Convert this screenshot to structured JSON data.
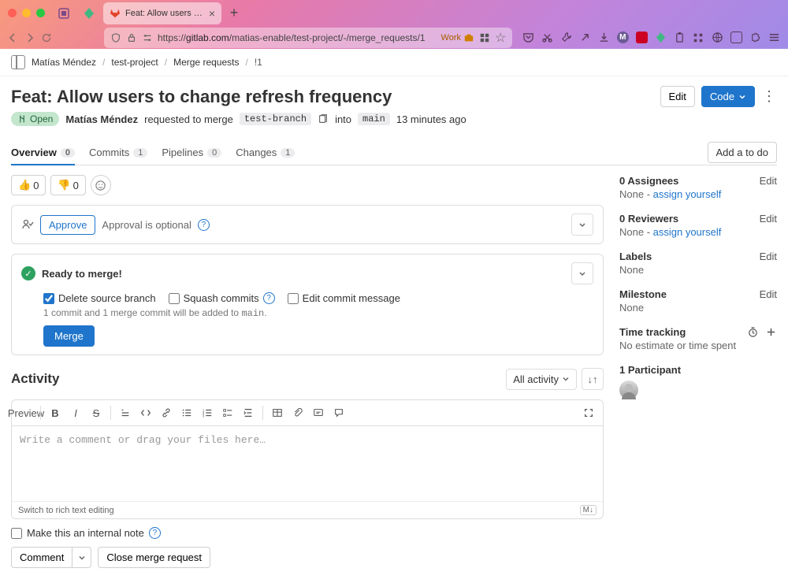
{
  "browser": {
    "tab_title": "Feat: Allow users to change ref…",
    "url_prefix": "https://",
    "url_host": "gitlab.com",
    "url_path": "/matias-enable/test-project/-/merge_requests/1",
    "work_label": "Work"
  },
  "breadcrumb": {
    "user": "Matías Méndez",
    "project": "test-project",
    "section": "Merge requests",
    "id": "!1"
  },
  "mr": {
    "title": "Feat: Allow users to change refresh frequency",
    "status": "Open",
    "author": "Matías Méndez",
    "action_text": "requested to merge",
    "source_branch": "test-branch",
    "into_text": "into",
    "target_branch": "main",
    "time_ago": "13 minutes ago",
    "edit_btn": "Edit",
    "code_btn": "Code"
  },
  "tabs": {
    "overview": "Overview",
    "overview_count": "0",
    "commits": "Commits",
    "commits_count": "1",
    "pipelines": "Pipelines",
    "pipelines_count": "0",
    "changes": "Changes",
    "changes_count": "1",
    "add_todo": "Add a to do"
  },
  "reactions": {
    "up": "0",
    "down": "0"
  },
  "approval": {
    "btn": "Approve",
    "text": "Approval is optional"
  },
  "merge": {
    "status": "Ready to merge!",
    "delete_branch": "Delete source branch",
    "squash": "Squash commits",
    "edit_msg": "Edit commit message",
    "note_pre": "1 commit and 1 merge commit will be added to ",
    "note_branch": "main",
    "note_post": ".",
    "btn": "Merge"
  },
  "activity": {
    "title": "Activity",
    "filter": "All activity",
    "preview": "Preview",
    "placeholder": "Write a comment or drag your files here…",
    "switch_text": "Switch to rich text editing",
    "md": "M↓"
  },
  "internal_note": "Make this an internal note",
  "comment_btn": "Comment",
  "close_btn": "Close merge request",
  "sidebar": {
    "assignees_title": "0 Assignees",
    "assignees_val_pre": "None - ",
    "assignees_link": "assign yourself",
    "reviewers_title": "0 Reviewers",
    "reviewers_val_pre": "None - ",
    "reviewers_link": "assign yourself",
    "labels_title": "Labels",
    "labels_val": "None",
    "milestone_title": "Milestone",
    "milestone_val": "None",
    "time_title": "Time tracking",
    "time_val": "No estimate or time spent",
    "participants_title": "1 Participant",
    "edit": "Edit"
  }
}
